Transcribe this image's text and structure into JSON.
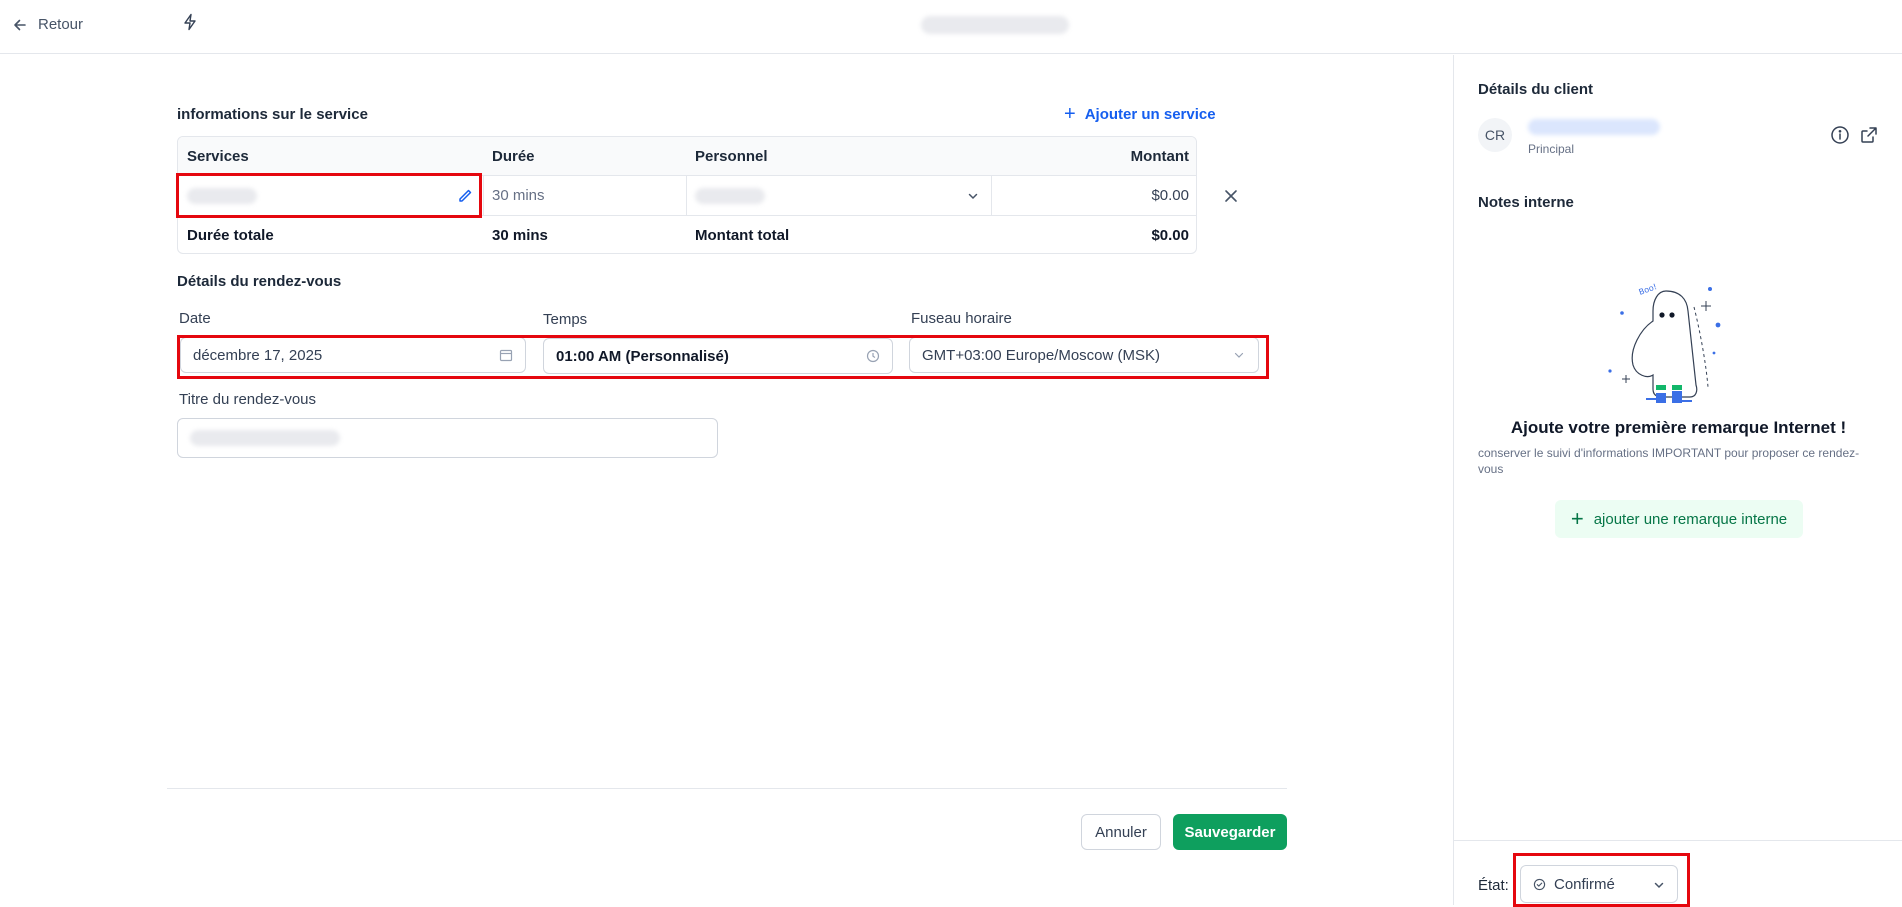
{
  "topbar": {
    "back_label": "Retour",
    "back_icon": "arrow-left-icon",
    "bolt_icon": "bolt-icon"
  },
  "service_section": {
    "title": "informations sur le service",
    "add_service_label": "Ajouter un service",
    "columns": [
      "Services",
      "Durée",
      "Personnel",
      "Montant"
    ],
    "row": {
      "duration": "30 mins",
      "amount": "$0.00"
    },
    "totals": {
      "label": "Durée totale",
      "duration": "30 mins",
      "amount_label": "Montant total",
      "amount": "$0.00"
    }
  },
  "appointment": {
    "title": "Détails du rendez-vous",
    "date_label": "Date",
    "date_value": "décembre 17, 2025",
    "time_label": "Temps",
    "time_value": "01:00 AM (Personnalisé)",
    "timezone_label": "Fuseau horaire",
    "timezone_value": "GMT+03:00 Europe/Moscow (MSK)",
    "appt_title_label": "Titre du rendez-vous"
  },
  "actions": {
    "cancel_label": "Annuler",
    "save_label": "Sauvegarder"
  },
  "client_panel": {
    "title": "Détails du client",
    "initials": "CR",
    "client_role": "Principal",
    "notes_title": "Notes interne",
    "empty_title": "Ajoute votre première remarque Internet !",
    "empty_subtitle": "conserver le suivi d'informations IMPORTANT pour proposer ce rendez-vous",
    "add_note_label": "ajouter une remarque interne",
    "status_label": "État:",
    "status_value": "Confirmé"
  },
  "colors": {
    "primary_blue": "#155eef",
    "save_green": "#0e9f5e",
    "highlight_red": "#e5070e"
  }
}
